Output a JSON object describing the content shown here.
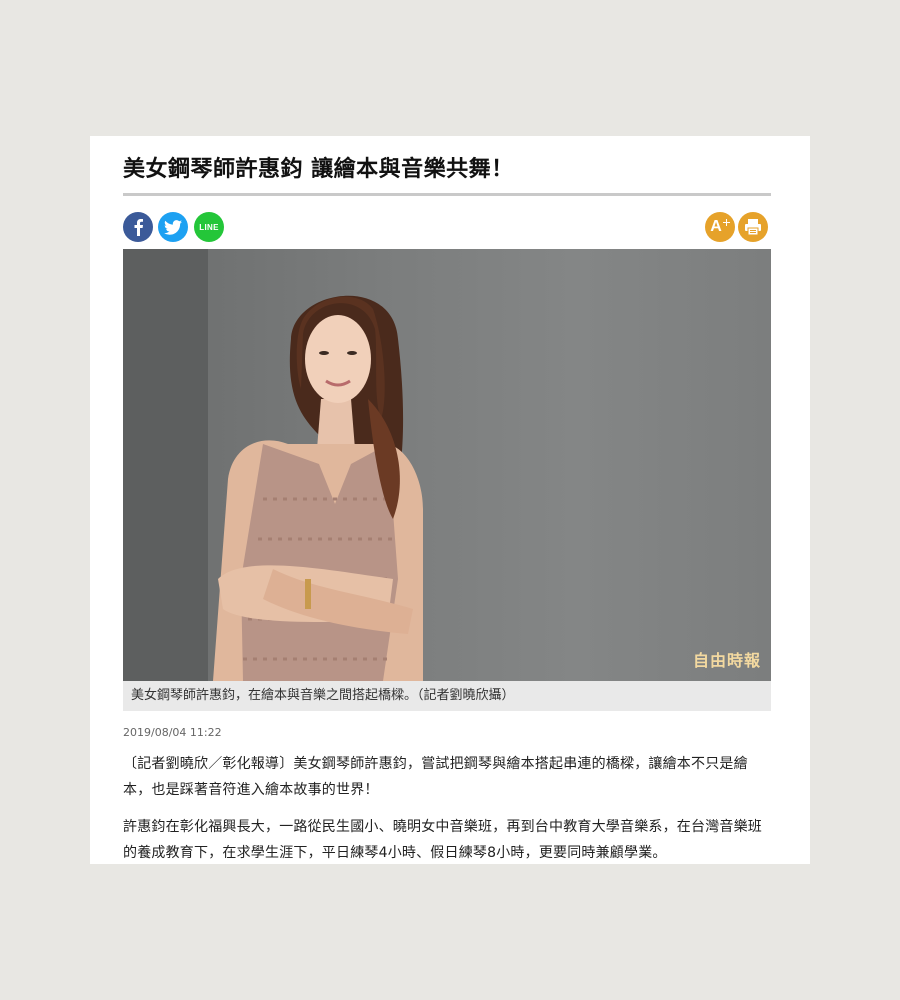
{
  "article": {
    "title": "美女鋼琴師許惠鈞 讓繪本與音樂共舞！",
    "caption": "美女鋼琴師許惠鈞，在繪本與音樂之間搭起橋樑。（記者劉曉欣攝）",
    "watermark": "自由時報",
    "date": "2019/08/04 11:22",
    "paragraphs": [
      "〔記者劉曉欣／彰化報導〕美女鋼琴師許惠鈞，嘗試把鋼琴與繪本搭起串連的橋樑，讓繪本不只是繪本，也是踩著音符進入繪本故事的世界！",
      "許惠鈞在彰化福興長大，一路從民生國小、曉明女中音樂班，再到台中教育大學音樂系，在台灣音樂班的養成教育下，在求學生涯下，平日練琴4小時、假日練琴8小時，更要同時兼顧學業。"
    ]
  },
  "share": {
    "facebook_icon": "facebook-icon",
    "twitter_icon": "twitter-icon",
    "line_label": "LINE"
  },
  "tools": {
    "font_size_label": "A",
    "print_icon": "print-icon"
  },
  "colors": {
    "facebook": "#3b5a99",
    "twitter": "#1da1f2",
    "line": "#24c639",
    "tool_accent": "#e6a22a"
  }
}
